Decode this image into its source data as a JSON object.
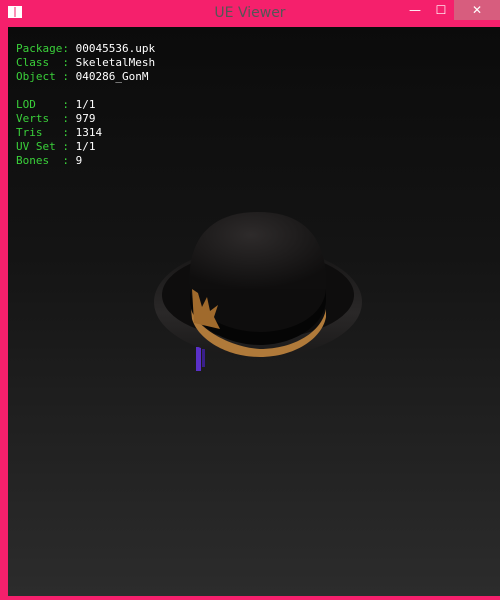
{
  "window": {
    "title": "UE Viewer",
    "minimize_glyph": "—",
    "maximize_glyph": "☐",
    "close_glyph": "✕",
    "accent_color": "#f5206c"
  },
  "info": {
    "package_label": "Package: ",
    "package_value": "00045536.upk",
    "class_label": "Class  : ",
    "class_value": "SkeletalMesh",
    "object_label": "Object : ",
    "object_value": "040286_GonM",
    "lod_label": "LOD    : ",
    "lod_value": "1/1",
    "verts_label": "Verts  : ",
    "verts_value": "979",
    "tris_label": "Tris   : ",
    "tris_value": "1314",
    "uvset_label": "UV Set : ",
    "uvset_value": "1/1",
    "bones_label": "Bones  : ",
    "bones_value": "9"
  },
  "label_color": "#3ad03a",
  "model": {
    "type": "bowler-hat",
    "colors": {
      "hat": "#1c1a1a",
      "band": "#000000",
      "trim": "#b07a3a",
      "tassel": "#5a30c8"
    }
  }
}
